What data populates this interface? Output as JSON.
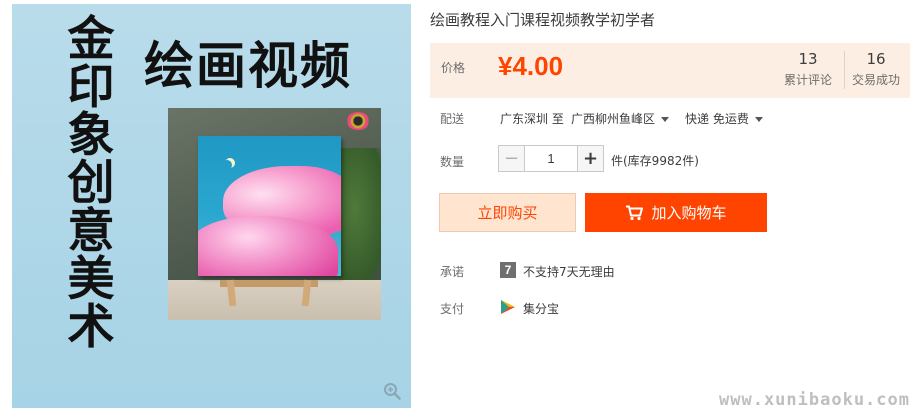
{
  "image": {
    "vertical_title": [
      "金",
      "印",
      "象",
      "创",
      "意",
      "美",
      "术"
    ],
    "main_title": "绘画视频",
    "zoom_icon": "magnifier-icon"
  },
  "product": {
    "title": "绘画教程入门课程视频教学初学者"
  },
  "price": {
    "label": "价格",
    "value": "¥4.00",
    "reviews_count": "13",
    "reviews_label": "累计评论",
    "sold_count": "16",
    "sold_label": "交易成功"
  },
  "shipping": {
    "label": "配送",
    "from": "广东深圳 至",
    "to": "广西柳州鱼峰区",
    "method": "快递 免运费"
  },
  "quantity": {
    "label": "数量",
    "value": "1",
    "stock": "件(库存9982件)"
  },
  "actions": {
    "buy_now": "立即购买",
    "add_to_cart": "加入购物车"
  },
  "promise": {
    "label": "承诺",
    "icon_text": "7",
    "text": "不支持7天无理由"
  },
  "payment": {
    "label": "支付",
    "method": "集分宝"
  },
  "watermark": "www.xunibaoku.com",
  "colors": {
    "accent": "#ff4400",
    "price_bg": "#fdeee4",
    "buy_bg": "#ffe4d0"
  }
}
